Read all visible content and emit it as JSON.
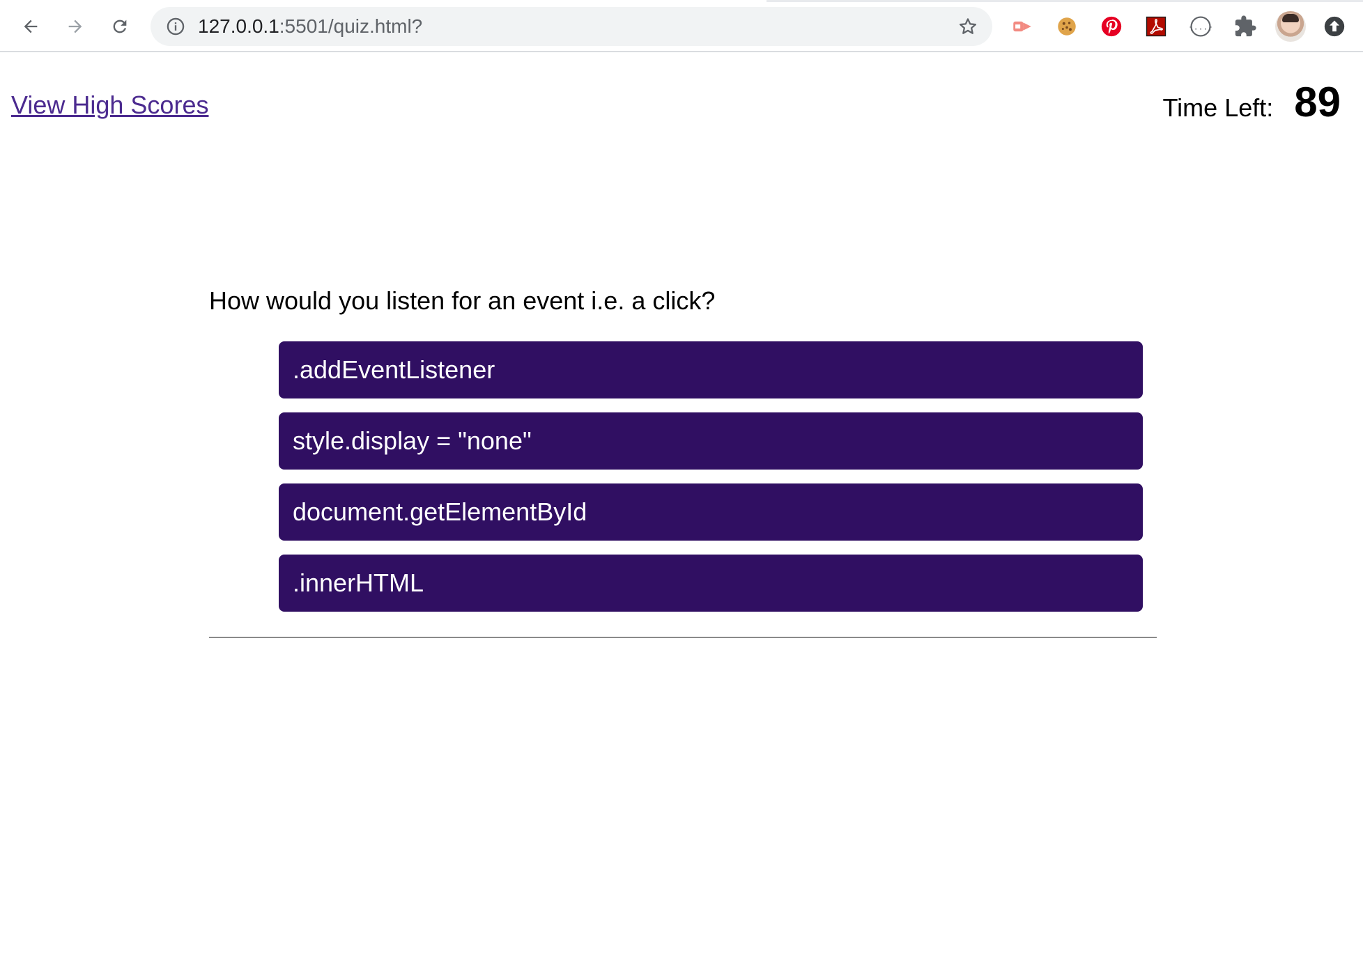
{
  "browser": {
    "url_host": "127.0.0.1",
    "url_rest": ":5501/quiz.html?",
    "icons": {
      "back": "back-arrow-icon",
      "forward": "forward-arrow-icon",
      "reload": "reload-icon",
      "info": "info-icon",
      "bookmark": "star-icon",
      "extensions": [
        "cast-extension-icon",
        "cookie-extension-icon",
        "pinterest-extension-icon",
        "acrobat-extension-icon",
        "json-extension-icon",
        "puzzle-extensions-icon",
        "profile-avatar",
        "update-icon"
      ]
    }
  },
  "header": {
    "high_scores_label": "View High Scores",
    "time_left_label": "Time Left:",
    "time_left_value": "89"
  },
  "quiz": {
    "question": "How would you listen for an event i.e. a click?",
    "answers": [
      ".addEventListener",
      "style.display = \"none\"",
      "document.getElementById",
      ".innerHTML"
    ]
  },
  "colors": {
    "answer_bg": "#300f62",
    "answer_text": "#ffffff",
    "link": "#4b2a8f"
  }
}
